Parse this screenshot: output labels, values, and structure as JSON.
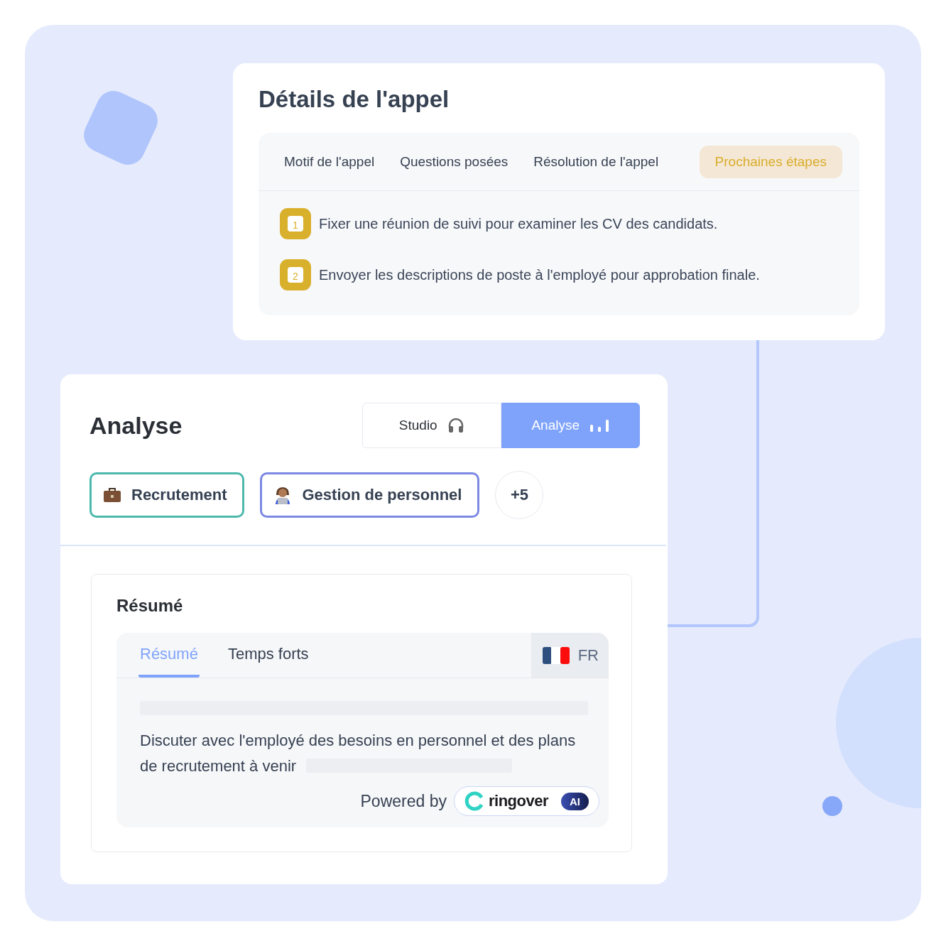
{
  "call_details": {
    "title": "Détails de l'appel",
    "tabs": [
      {
        "label": "Motif de l'appel",
        "selected": false
      },
      {
        "label": "Questions posées",
        "selected": false
      },
      {
        "label": "Résolution de l'appel",
        "selected": false
      },
      {
        "label": "Prochaines étapes",
        "selected": true
      }
    ],
    "steps": [
      {
        "number": "1",
        "text": "Fixer une réunion de suivi pour examiner les CV des candidats."
      },
      {
        "number": "2",
        "text": "Envoyer les descriptions de poste à l'employé pour approbation finale."
      }
    ]
  },
  "analysis": {
    "title": "Analyse",
    "modes": [
      {
        "label": "Studio",
        "selected": false,
        "kind": "headphones"
      },
      {
        "label": "Analyse",
        "selected": true,
        "kind": "bars"
      }
    ],
    "tags": [
      {
        "label": "Recrutement",
        "kind": "briefcase",
        "color": "#4cb8ac"
      },
      {
        "label": "Gestion de personnel",
        "kind": "worker",
        "color": "#7c88e4"
      }
    ],
    "more": "+5",
    "summary": {
      "title": "Résumé",
      "tabs": [
        {
          "label": "Résumé",
          "selected": true
        },
        {
          "label": "Temps forts",
          "selected": false
        }
      ],
      "language": "FR",
      "text": "Discuter avec l'employé des besoins en personnel et des plans de recrutement à venir",
      "powered_by": "Powered by",
      "brand": "ringover",
      "brand_badge": "AI"
    }
  }
}
